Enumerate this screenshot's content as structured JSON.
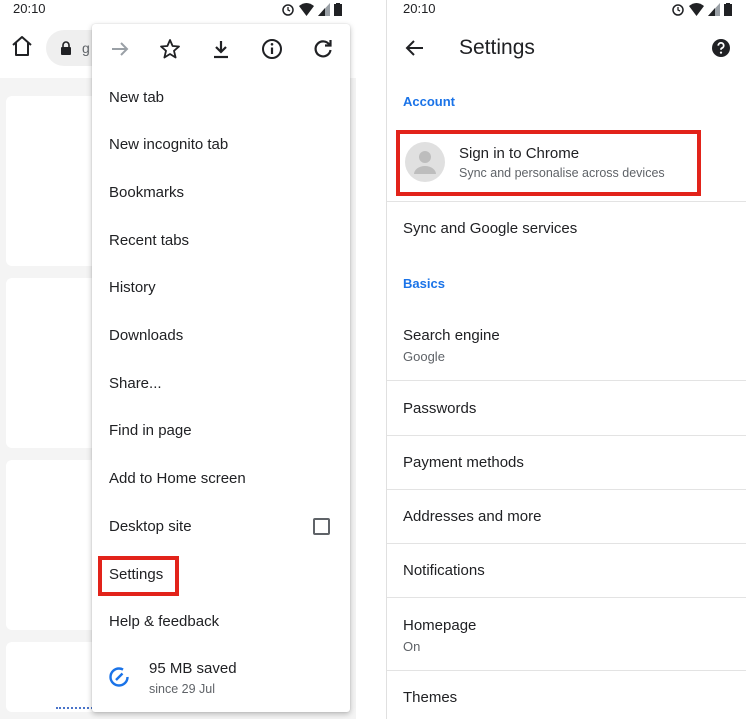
{
  "left": {
    "status": {
      "time": "20:10"
    },
    "omnibox": {
      "url_fragment": "g"
    },
    "menu": {
      "items": [
        "New tab",
        "New incognito tab",
        "Bookmarks",
        "Recent tabs",
        "History",
        "Downloads",
        "Share...",
        "Find in page",
        "Add to Home screen",
        "Desktop site",
        "Settings",
        "Help & feedback"
      ],
      "saved": {
        "title": "95 MB saved",
        "subtitle": "since 29 Jul"
      }
    }
  },
  "right": {
    "status": {
      "time": "20:10"
    },
    "appbar": {
      "title": "Settings"
    },
    "account_header": "Account",
    "signin": {
      "title": "Sign in to Chrome",
      "subtitle": "Sync and personalise across devices"
    },
    "sync_row": "Sync and Google services",
    "basics_header": "Basics",
    "rows": [
      {
        "title": "Search engine",
        "subtitle": "Google"
      },
      {
        "title": "Passwords"
      },
      {
        "title": "Payment methods"
      },
      {
        "title": "Addresses and more"
      },
      {
        "title": "Notifications"
      },
      {
        "title": "Homepage",
        "subtitle": "On"
      },
      {
        "title": "Themes"
      }
    ]
  },
  "colors": {
    "accent": "#1a73e8",
    "highlight": "#e2231a",
    "saved_icon": "#1a73e8"
  }
}
